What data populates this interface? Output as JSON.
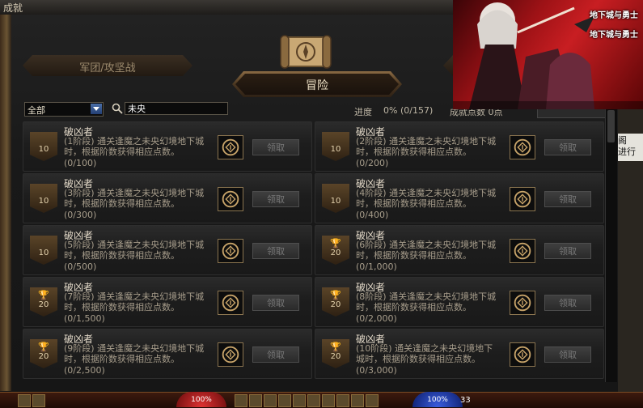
{
  "window": {
    "title": "成就"
  },
  "tabs": {
    "left": "军团/攻坚战",
    "active": "冒险"
  },
  "filter": {
    "category": "全部",
    "search_value": "未央"
  },
  "progress": {
    "label": "进度",
    "value": "0%  (0/157)",
    "points_label": "成就点数 0点"
  },
  "claim_label": "领取",
  "cards": [
    {
      "title": "破凶者",
      "desc": "(1阶段) 通关逢魔之未央幻境地下城时，根据阶数获得相应点数。",
      "count": "(0/100)",
      "badge": "10",
      "trophy": false
    },
    {
      "title": "破凶者",
      "desc": "(2阶段) 通关逢魔之未央幻境地下城时，根据阶数获得相应点数。",
      "count": "(0/200)",
      "badge": "10",
      "trophy": false
    },
    {
      "title": "破凶者",
      "desc": "(3阶段) 通关逢魔之未央幻境地下城时，根据阶数获得相应点数。",
      "count": "(0/300)",
      "badge": "10",
      "trophy": false
    },
    {
      "title": "破凶者",
      "desc": "(4阶段) 通关逢魔之未央幻境地下城时，根据阶数获得相应点数。",
      "count": "(0/400)",
      "badge": "10",
      "trophy": false
    },
    {
      "title": "破凶者",
      "desc": "(5阶段) 通关逢魔之未央幻境地下城时，根据阶数获得相应点数。",
      "count": "(0/500)",
      "badge": "10",
      "trophy": false
    },
    {
      "title": "破凶者",
      "desc": "(6阶段) 通关逢魔之未央幻境地下城时，根据阶数获得相应点数。",
      "count": "(0/1,000)",
      "badge": "20",
      "trophy": true
    },
    {
      "title": "破凶者",
      "desc": "(7阶段) 通关逢魔之未央幻境地下城时，根据阶数获得相应点数。",
      "count": "(0/1,500)",
      "badge": "20",
      "trophy": true
    },
    {
      "title": "破凶者",
      "desc": "(8阶段) 通关逢魔之未央幻境地下城时，根据阶数获得相应点数。",
      "count": "(0/2,000)",
      "badge": "20",
      "trophy": true
    },
    {
      "title": "破凶者",
      "desc": "(9阶段) 通关逢魔之未央幻境地下城时，根据阶数获得相应点数。",
      "count": "(0/2,500)",
      "badge": "20",
      "trophy": true
    },
    {
      "title": "破凶者",
      "desc": "(10阶段) 通关逢魔之未央幻境地下城时，根据阶数获得相应点数。",
      "count": "(0/3,000)",
      "badge": "20",
      "trophy": true
    }
  ],
  "banner": {
    "logo_top": "地下城与勇士",
    "logo_bottom": "地下城与勇士"
  },
  "side": {
    "frag1": "阁",
    "frag2": "进行"
  },
  "hud": {
    "hp": "100%",
    "mp": "100%",
    "level": "33"
  },
  "icons": {
    "search": "search-icon",
    "scroll": "scroll-emblem-icon",
    "trophy": "trophy-icon",
    "reward": "reward-emblem-icon",
    "dropdown": "chevron-down-icon"
  }
}
